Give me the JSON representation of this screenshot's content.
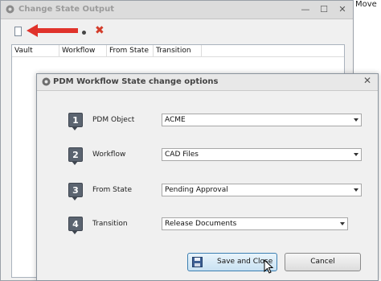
{
  "behind_window": {
    "visible_text": "Move"
  },
  "output_window": {
    "title": "Change State Output",
    "buttons": {
      "minimize": "—",
      "maximize": "☐",
      "close": "✕"
    },
    "toolbar": {
      "delete_glyph": "✖"
    },
    "columns": [
      "Vault",
      "Workflow",
      "From State",
      "Transition"
    ]
  },
  "dialog": {
    "title": "PDM Workflow State change options",
    "close_glyph": "✕",
    "rows": [
      {
        "step": "1",
        "label": "PDM Object",
        "value": "ACME"
      },
      {
        "step": "2",
        "label": "Workflow",
        "value": "CAD Files"
      },
      {
        "step": "3",
        "label": "From State",
        "value": "Pending Approval"
      },
      {
        "step": "4",
        "label": "Transition",
        "value": "Release Documents"
      }
    ],
    "buttons": {
      "save": "Save and Close",
      "cancel": "Cancel"
    }
  },
  "colors": {
    "arrow_red": "#e0332b",
    "badge": "#5b6470",
    "save_button": "#c8e1f2"
  }
}
